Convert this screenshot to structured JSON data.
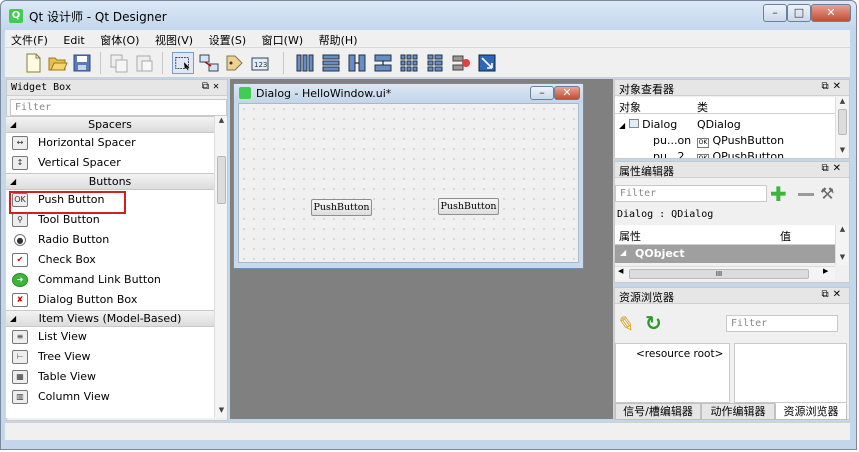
{
  "window": {
    "title": "Qt 设计师 - Qt Designer",
    "minimize": "–",
    "maximize": "□",
    "close": "✕"
  },
  "menu": [
    "文件(F)",
    "Edit",
    "窗体(O)",
    "视图(V)",
    "设置(S)",
    "窗口(W)",
    "帮助(H)"
  ],
  "toolbar": {
    "icons": [
      "new-file-icon",
      "open-folder-icon",
      "save-icon",
      "copy-icon",
      "paste-icon",
      "edit-widgets-icon",
      "edit-signals-icon",
      "edit-buddies-icon",
      "edit-tab-order-icon",
      "layout-horizontal-icon",
      "layout-vertical-icon",
      "layout-h-splitter-icon",
      "layout-v-splitter-icon",
      "layout-grid-icon",
      "layout-form-icon",
      "break-layout-icon",
      "adjust-size-icon"
    ]
  },
  "widget_box": {
    "title": "Widget Box",
    "filter_placeholder": "Filter",
    "categories": [
      {
        "label": "Spacers",
        "items": [
          "Horizontal Spacer",
          "Vertical Spacer"
        ]
      },
      {
        "label": "Buttons",
        "items": [
          "Push Button",
          "Tool Button",
          "Radio Button",
          "Check Box",
          "Command Link Button",
          "Dialog Button Box"
        ]
      },
      {
        "label": "Item Views (Model-Based)",
        "items": [
          "List View",
          "Tree View",
          "Table View",
          "Column View"
        ]
      }
    ]
  },
  "form": {
    "title": "Dialog - HelloWindow.ui*",
    "button1": "PushButton",
    "button2": "PushButton"
  },
  "object_inspector": {
    "title": "对象查看器",
    "col_object": "对象",
    "col_class": "类",
    "rows": [
      {
        "object": "Dialog",
        "class": "QDialog"
      },
      {
        "object": "pu...on",
        "class": "QPushButton"
      },
      {
        "object": "pu...2",
        "class": "QPushButton"
      }
    ]
  },
  "property_editor": {
    "title": "属性编辑器",
    "filter_placeholder": "Filter",
    "context": "Dialog : QDialog",
    "col_property": "属性",
    "col_value": "值",
    "group": "QObject",
    "hscroll_label": "III"
  },
  "resource_browser": {
    "title": "资源浏览器",
    "filter_placeholder": "Filter",
    "root": "<resource root>"
  },
  "bottom_tabs": [
    "信号/槽编辑器",
    "动作编辑器",
    "资源浏览器"
  ],
  "colors": {
    "highlight_border": "#d02020",
    "selected_row": "#9f9f9f",
    "plus_green": "#3bb53b"
  }
}
